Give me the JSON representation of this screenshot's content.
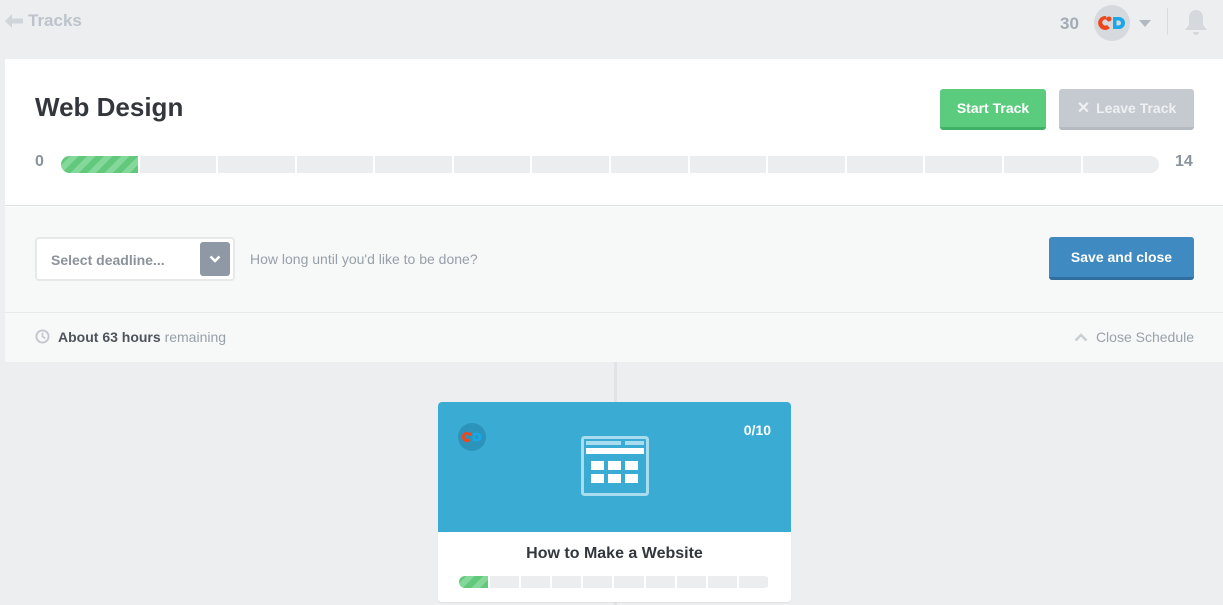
{
  "topbar": {
    "back_label": "Tracks",
    "points": "30",
    "avatar_initials": "CD"
  },
  "track": {
    "title": "Web Design",
    "start_label": "Start Track",
    "leave_label": "Leave Track",
    "progress": {
      "min_label": "0",
      "max_label": "14",
      "completed_segments": 1,
      "total_segments": 14
    }
  },
  "schedule": {
    "deadline_placeholder": "Select deadline...",
    "hint": "How long until you'd like to be done?",
    "save_label": "Save and close",
    "remaining_bold": "About 63 hours",
    "remaining_suffix": "remaining",
    "close_label": "Close Schedule"
  },
  "courses": [
    {
      "title": "How to Make a Website",
      "count": "0/10",
      "icon": "layout-grid-icon",
      "color": "#3aabd2",
      "completed_segments": 1,
      "total_segments": 10
    }
  ],
  "colors": {
    "accent_green": "#5bcc7e",
    "accent_blue": "#3e8ac1",
    "card_blue": "#3aabd2"
  }
}
